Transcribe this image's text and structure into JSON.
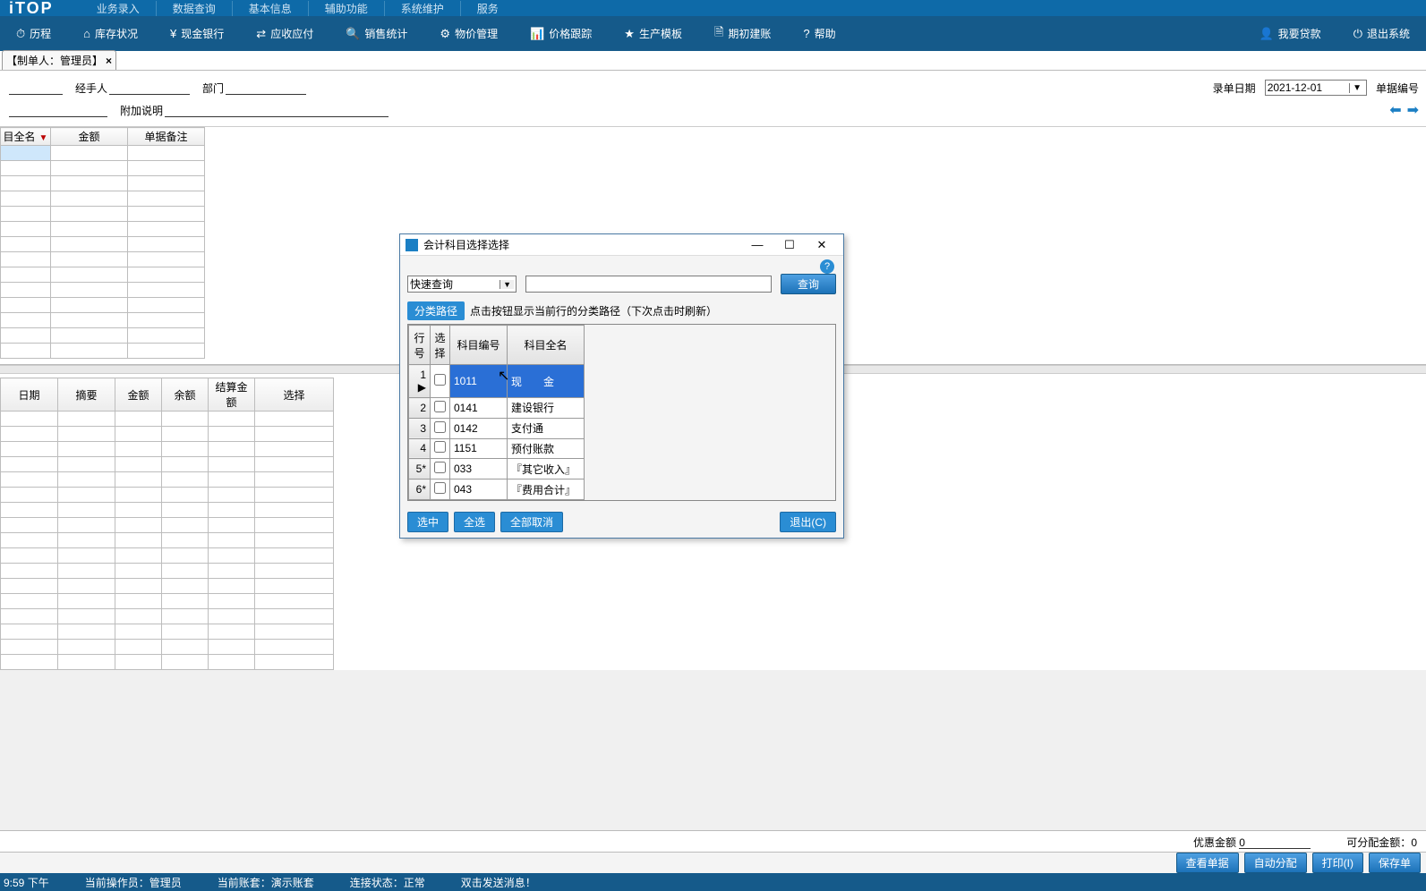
{
  "brand": "iTOP",
  "top_nav": [
    "业务录入",
    "数据查询",
    "基本信息",
    "辅助功能",
    "系统维护",
    "服务"
  ],
  "toolbar": [
    {
      "icon": "⏱",
      "label": "历程"
    },
    {
      "icon": "⌂",
      "label": "库存状况"
    },
    {
      "icon": "¥",
      "label": "现金银行"
    },
    {
      "icon": "⇄",
      "label": "应收应付"
    },
    {
      "icon": "🔍",
      "label": "销售统计"
    },
    {
      "icon": "⚙",
      "label": "物价管理"
    },
    {
      "icon": "📊",
      "label": "价格跟踪"
    },
    {
      "icon": "★",
      "label": "生产模板"
    },
    {
      "icon": "🗎",
      "label": "期初建账"
    },
    {
      "icon": "?",
      "label": "帮助"
    }
  ],
  "toolbar_right": [
    {
      "icon": "👤",
      "label": "我要贷款"
    },
    {
      "icon": "⏻",
      "label": "退出系统"
    }
  ],
  "tab": {
    "label": "【制单人：管理员】",
    "close": "×"
  },
  "doc": {
    "handler_label": "经手人",
    "dept_label": "部门",
    "extra_label": "附加说明",
    "entry_date_label": "录单日期",
    "entry_date": "2021-12-01",
    "docno_label": "单据编号"
  },
  "grid1_headers": [
    "目全名",
    "金额",
    "单据备注"
  ],
  "grid2_headers": [
    "日期",
    "摘要",
    "金额",
    "余额",
    "结算金额",
    "选择"
  ],
  "footer": {
    "discount_label": "优惠金额",
    "discount_value": "0",
    "alloc_label": "可分配金额：",
    "alloc_value": "0"
  },
  "actions": [
    "查看单据",
    "自动分配",
    "打印(I)",
    "保存单"
  ],
  "status": {
    "time": "9:59 下午",
    "op_label": "当前操作员：",
    "op": "管理员",
    "acct_label": "当前账套：",
    "acct": "演示账套",
    "conn_label": "连接状态：",
    "conn": "正常",
    "msg": "双击发送消息！"
  },
  "modal": {
    "title": "会计科目选择选择",
    "combo": "快速查询",
    "search_btn": "查询",
    "path_btn": "分类路径",
    "path_hint": "点击按钮显示当前行的分类路径（下次点击时刷新）",
    "headers": [
      "行号",
      "选择",
      "科目编号",
      "科目全名"
    ],
    "rows": [
      {
        "n": "1",
        "code": "1011",
        "name": "现　　金",
        "hl": true,
        "ptr": true
      },
      {
        "n": "2",
        "code": "0141",
        "name": "建设银行"
      },
      {
        "n": "3",
        "code": "0142",
        "name": "支付通"
      },
      {
        "n": "4",
        "code": "1151",
        "name": "预付账款"
      },
      {
        "n": "5*",
        "code": "033",
        "name": "『其它收入』"
      },
      {
        "n": "6*",
        "code": "043",
        "name": "『费用合计』"
      }
    ],
    "btns": [
      "选中",
      "全选",
      "全部取消"
    ],
    "exit": "退出(C)"
  }
}
